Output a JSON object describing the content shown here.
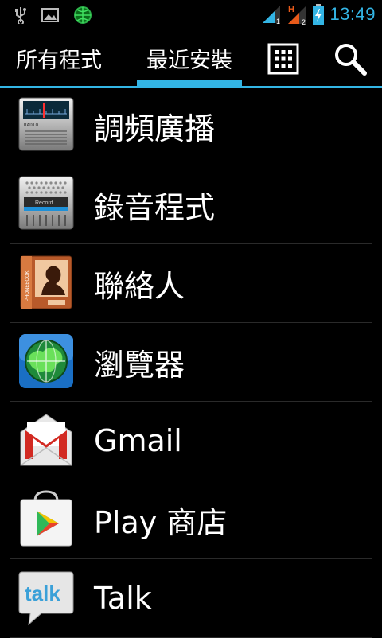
{
  "status_bar": {
    "time": "13:49",
    "icons": [
      "usb-icon",
      "image-icon",
      "globe-icon",
      "signal-1-icon",
      "signal-h-icon",
      "battery-charging-icon"
    ]
  },
  "tabs": [
    {
      "label": "所有程式",
      "selected": false
    },
    {
      "label": "最近安裝",
      "selected": true
    }
  ],
  "actions": {
    "grid": "grid-view-icon",
    "search": "search-icon"
  },
  "apps": [
    {
      "label": "調頻廣播",
      "icon": "fm-radio-icon",
      "icon_text": "RADIO"
    },
    {
      "label": "錄音程式",
      "icon": "sound-recorder-icon",
      "icon_text": "Record"
    },
    {
      "label": "聯絡人",
      "icon": "contacts-icon",
      "icon_text": "PHONEBOOK"
    },
    {
      "label": "瀏覽器",
      "icon": "browser-globe-icon"
    },
    {
      "label": "Gmail",
      "icon": "gmail-icon"
    },
    {
      "label": "Play 商店",
      "icon": "play-store-icon"
    },
    {
      "label": "Talk",
      "icon": "talk-icon",
      "icon_text": "talk"
    }
  ],
  "colors": {
    "accent": "#33b5e5",
    "background": "#000000",
    "divider": "#2a2a2a"
  }
}
